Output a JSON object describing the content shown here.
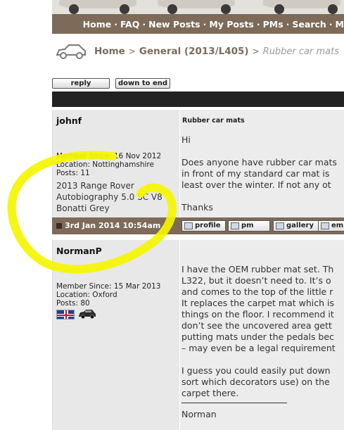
{
  "nav": {
    "home": "Home",
    "faq": "FAQ",
    "new_posts": "New Posts",
    "my_posts": "My Posts",
    "pms": "PMs",
    "search": "Search",
    "more": "M",
    "sep": "·"
  },
  "breadcrumb": {
    "home": "Home",
    "arrow": ">",
    "forum": "General (2013/L405)",
    "current": "Rubber car mats"
  },
  "buttons": {
    "reply": "reply",
    "down_to_end": "down to end"
  },
  "posts": [
    {
      "username": "johnf",
      "member_since": "Member Since: 16 Nov 2012",
      "location": "Location: Nottinghamshire",
      "posts": "Posts: 11",
      "car_line1": "2013 Range Rover",
      "car_line2": "Autobiography 5.0 SC V8",
      "car_line3": "Bonatti Grey",
      "subject": "Rubber car mats",
      "body": [
        "Hi",
        "",
        "Does anyone have rubber car mats",
        "in front of my standard car mat is",
        "least over the winter. If not any ot",
        "",
        "Thanks"
      ],
      "date": "3rd Jan 2014 10:54am",
      "actions": [
        "profile",
        "pm",
        "gallery",
        "em"
      ]
    },
    {
      "username": "NormanP",
      "member_since": "Member Since: 15 Mar 2013",
      "location": "Location: Oxford",
      "posts": "Posts: 80",
      "body": [
        "I have the OEM rubber mat set. Th",
        "L322, but it doesn’t need to. It’s o",
        "and comes to the top of the little r",
        "It replaces the carpet mat which is",
        "things on the floor. I recommend it",
        "don’t see the uncovered area gett",
        "putting mats under the pedals bec",
        "– may even be a legal requirement",
        "",
        "I guess you could easily put down",
        "sort which decorators use) on the",
        "carpet there.",
        "",
        "Norman"
      ]
    }
  ],
  "colors": {
    "nav_brown": "#7e6a58",
    "annotation_yellow": "#f5f500",
    "sidebar_grey": "#e8e8e8"
  }
}
